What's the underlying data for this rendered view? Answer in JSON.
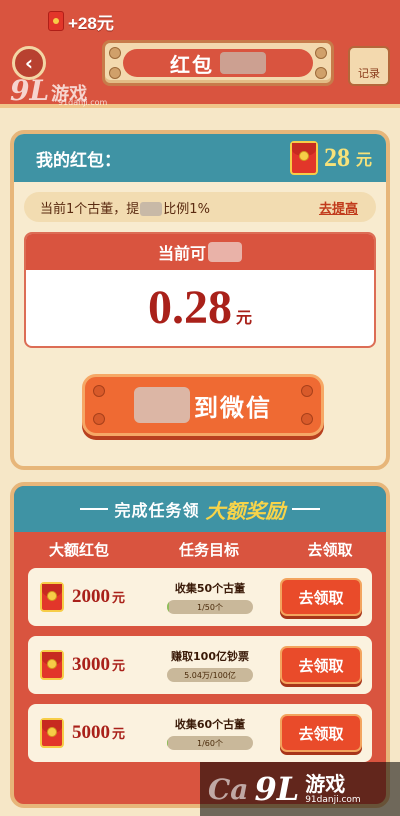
{
  "header": {
    "reward_toast": "+28元",
    "back_icon": "back-arrow-icon",
    "title": "红包",
    "record_label": "记录"
  },
  "watermark": {
    "logo_numeral": "9L",
    "name": "游戏",
    "url": "91danji.com",
    "bottom_numeral": "9L",
    "bottom_name": "游戏",
    "bottom_url": "91danji.com",
    "bottom_letters": "Ca"
  },
  "wallet": {
    "label": "我的红包：",
    "amount": "28",
    "unit": "元",
    "ratio_prefix": "当前1个古董，",
    "ratio_mid": "比例1%",
    "ratio_visible_char": "提",
    "improve_link": "去提高",
    "withdraw_head": "当前可",
    "withdraw_amount": "0.28",
    "withdraw_unit": "元",
    "wechat_button": "到微信"
  },
  "tasks": {
    "banner_text": "完成任务领",
    "banner_highlight": "大额奖励",
    "columns": [
      "大额红包",
      "任务目标",
      "去领取"
    ],
    "rows": [
      {
        "reward": "2000",
        "unit": "元",
        "goal": "收集50个古董",
        "progress_label": "1/50个",
        "progress": 0.02,
        "button": "去领取"
      },
      {
        "reward": "3000",
        "unit": "元",
        "goal": "赚取100亿钞票",
        "progress_label": "5.04万/100亿",
        "progress": 0.0,
        "button": "去领取"
      },
      {
        "reward": "5000",
        "unit": "元",
        "goal": "收集60个古董",
        "progress_label": "1/60个",
        "progress": 0.017,
        "button": "去领取"
      }
    ]
  },
  "colors": {
    "header_red": "#d9543f",
    "teal": "#3f93a4",
    "cream": "#f6e7c7",
    "amount_red": "#a9211a",
    "gold": "#f7e27a"
  }
}
